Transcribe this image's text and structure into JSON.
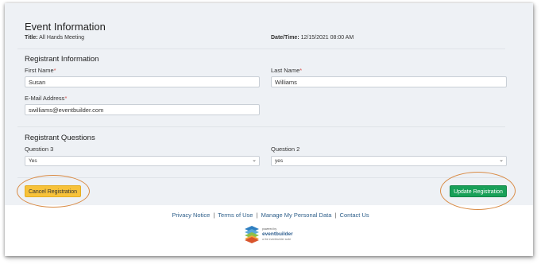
{
  "event": {
    "heading": "Event Information",
    "title_label": "Title:",
    "title_value": "All Hands Meeting",
    "datetime_label": "Date/Time:",
    "datetime_value": "12/15/2021 08:00 AM"
  },
  "registrant": {
    "heading": "Registrant Information",
    "first_name_label": "First Name",
    "first_name_value": "Susan",
    "last_name_label": "Last Name",
    "last_name_value": "Williams",
    "email_label": "E-Mail Address",
    "email_value": "swilliams@eventbuilder.com",
    "required_mark": "*"
  },
  "questions": {
    "heading": "Registrant Questions",
    "q3_label": "Question 3",
    "q3_value": "Yes",
    "q2_label": "Question 2",
    "q2_value": "yes"
  },
  "actions": {
    "cancel_label": "Cancel Registration",
    "update_label": "Update Registration"
  },
  "footer": {
    "links": [
      "Privacy Notice",
      "Terms of Use",
      "Manage My Personal Data",
      "Contact Us"
    ],
    "separator": "|",
    "logo_small": "powered by",
    "logo_name": "eventbuilder",
    "logo_tagline": "a the eventbuilder suite"
  },
  "colors": {
    "panel_bg": "#eef1f5",
    "cancel_button": "#f7c23a",
    "update_button": "#18a058",
    "highlight_ring": "#d98b45",
    "link": "#2e5f8a",
    "required": "#d9534f"
  },
  "icons": {
    "select_caret": "chevron-down-icon",
    "logo": "eventbuilder-logo-icon"
  }
}
